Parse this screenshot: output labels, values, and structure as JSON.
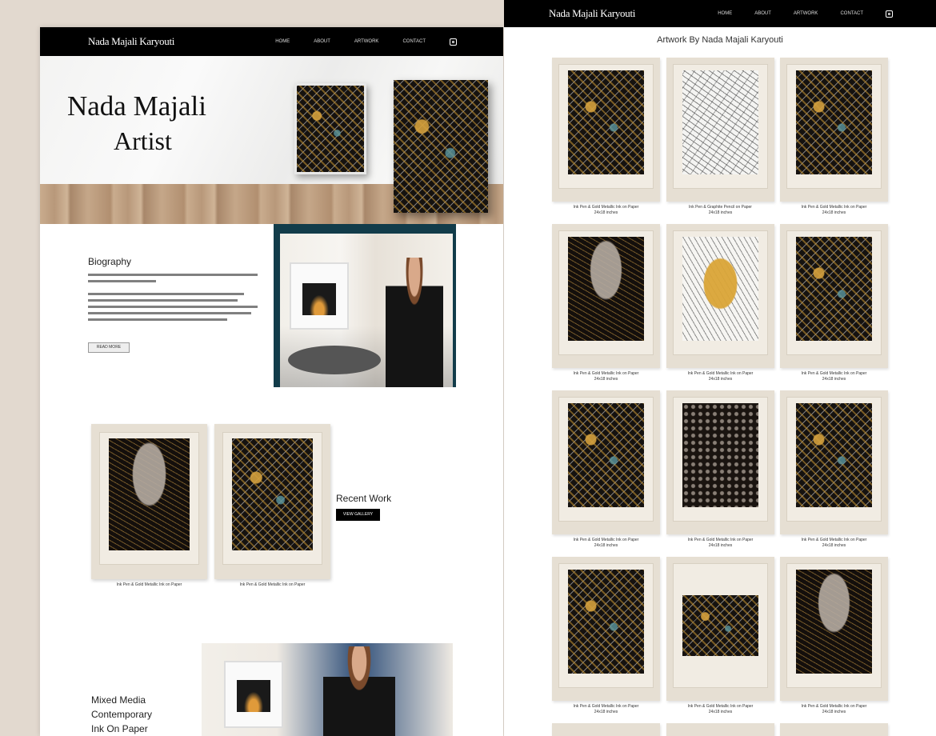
{
  "left": {
    "nav": {
      "brand": "Nada Majali Karyouti",
      "links": [
        "HOME",
        "ABOUT",
        "ARTWORK",
        "CONTACT"
      ]
    },
    "hero": {
      "title": "Nada Majali",
      "subtitle": "Artist"
    },
    "bio": {
      "heading": "Biography",
      "button_label": "READ MORE"
    },
    "recent": {
      "heading": "Recent Work",
      "button_label": "VIEW GALLERY",
      "captions": [
        "Ink Pen & Gold Metallic Ink on Paper",
        "Ink Pen & Gold Metallic Ink on Paper"
      ]
    },
    "media": {
      "lines": [
        "Mixed Media",
        "Contemporary",
        "Ink On Paper"
      ]
    }
  },
  "right": {
    "nav": {
      "brand": "Nada Majali Karyouti",
      "links": [
        "HOME",
        "ABOUT",
        "ARTWORK",
        "CONTACT"
      ]
    },
    "gallery_title": "Artwork By Nada Majali Karyouti",
    "captions": [
      [
        "Ink Pen & Gold Metallic Ink on Paper",
        "24x18 inches"
      ],
      [
        "Ink Pen & Graphite Pencil on Paper",
        "24x18 inches"
      ],
      [
        "Ink Pen & Gold Metallic Ink on Paper",
        "24x18 inches"
      ],
      [
        "Ink Pen & Gold Metallic Ink on Paper",
        "24x18 inches"
      ],
      [
        "Ink Pen & Gold Metallic Ink on Paper",
        "24x18 inches"
      ],
      [
        "Ink Pen & Gold Metallic Ink on Paper",
        "24x18 inches"
      ],
      [
        "Ink Pen & Gold Metallic Ink on Paper",
        "24x18 inches"
      ],
      [
        "Ink Pen & Gold Metallic Ink on Paper",
        "24x18 inches"
      ],
      [
        "Ink Pen & Gold Metallic Ink on Paper",
        "24x18 inches"
      ],
      [
        "Ink Pen & Gold Metallic Ink on Paper",
        "24x18 inches"
      ],
      [
        "Ink Pen & Gold Metallic Ink on Paper",
        "24x18 inches"
      ],
      [
        "Ink Pen & Gold Metallic Ink on Paper",
        "24x18 inches"
      ]
    ]
  },
  "icons": [
    "instagram-icon"
  ],
  "colors": {
    "nav_bg": "#000000",
    "page_bg": "#e2d9cf",
    "card_bg": "#e6dfd3",
    "bio_frame": "#123c4a"
  }
}
